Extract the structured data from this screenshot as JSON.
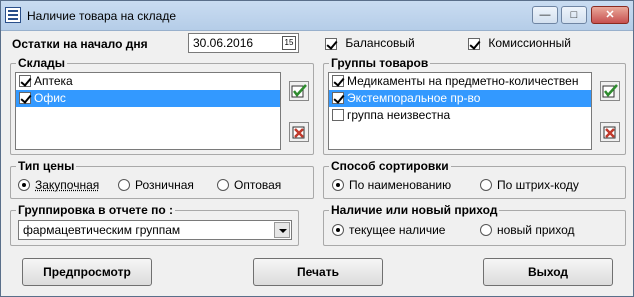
{
  "window": {
    "title": "Наличие товара на складе",
    "controls": {
      "minimize": "—",
      "maximize": "□",
      "close": "✕"
    }
  },
  "header": {
    "start_label": "Остатки на начало дня",
    "date_value": "30.06.2016",
    "calendar_glyph": "15",
    "balance_label": "Балансовый",
    "balance_checked": true,
    "commission_label": "Комиссионный",
    "commission_checked": true
  },
  "warehouses": {
    "title": "Склады",
    "items": [
      {
        "label": "Аптека",
        "checked": true,
        "selected": false
      },
      {
        "label": "Офис",
        "checked": true,
        "selected": true
      }
    ]
  },
  "product_groups": {
    "title": "Группы товаров",
    "items": [
      {
        "label": "Медикаменты на предметно-количествен",
        "checked": true,
        "selected": false
      },
      {
        "label": "Экстемпоральное пр-во",
        "checked": true,
        "selected": true
      },
      {
        "label": "группа неизвестна",
        "checked": false,
        "selected": false
      }
    ]
  },
  "price_type": {
    "title": "Тип цены",
    "options": [
      "Закупочная",
      "Розничная",
      "Оптовая"
    ],
    "selected": "Закупочная"
  },
  "sort_method": {
    "title": "Способ сортировки",
    "options": [
      "По наименованию",
      "По штрих-коду"
    ],
    "selected": "По наименованию"
  },
  "grouping": {
    "title": "Группировка в отчете по :",
    "value": "фармацевтическим группам"
  },
  "availability": {
    "title": "Наличие или новый приход",
    "options": [
      "текущее наличие",
      "новый приход"
    ],
    "selected": "текущее наличие"
  },
  "buttons": {
    "preview": "Предпросмотр",
    "print": "Печать",
    "exit": "Выход"
  },
  "colors": {
    "selection": "#3399ff",
    "check_icon": "#2e8b2e",
    "delete_icon": "#c0392b"
  }
}
